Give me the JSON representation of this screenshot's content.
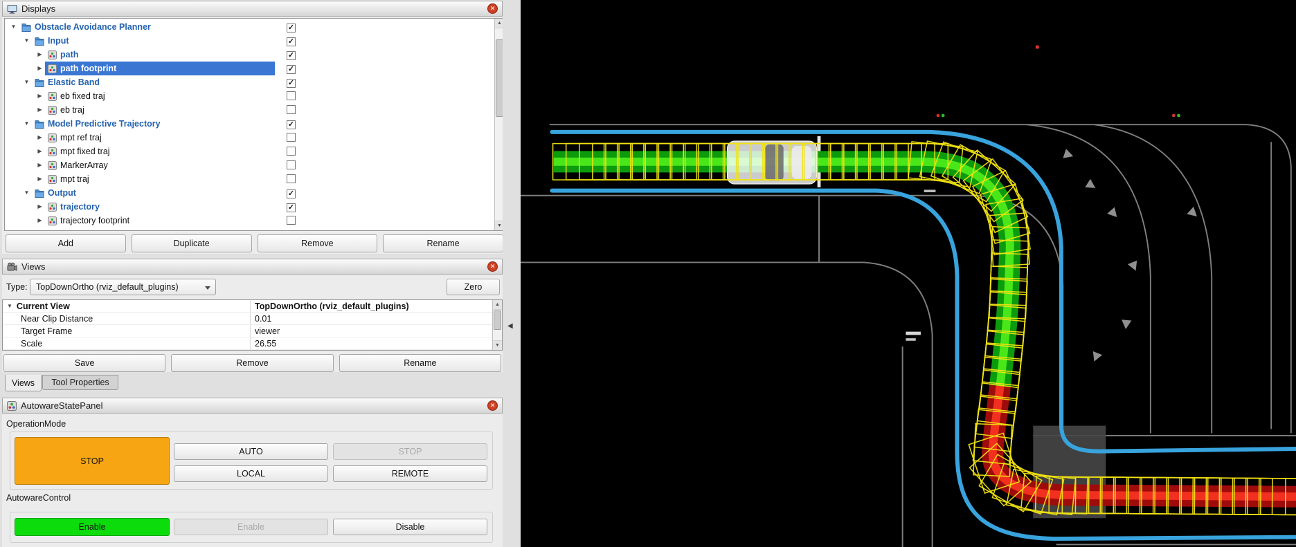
{
  "displays_panel": {
    "title": "Displays",
    "buttons": [
      "Add",
      "Duplicate",
      "Remove",
      "Rename"
    ],
    "tree": [
      {
        "label": "Obstacle Avoidance Planner",
        "level": 0,
        "kind": "folder",
        "expanded": true,
        "checked": true,
        "selected": false
      },
      {
        "label": "Input",
        "level": 1,
        "kind": "folder",
        "expanded": true,
        "checked": true,
        "selected": false
      },
      {
        "label": "path",
        "level": 2,
        "kind": "display",
        "expanded": false,
        "checked": true,
        "selected": false
      },
      {
        "label": "path footprint",
        "level": 2,
        "kind": "display",
        "expanded": false,
        "checked": true,
        "selected": true
      },
      {
        "label": "Elastic Band",
        "level": 1,
        "kind": "folder",
        "expanded": true,
        "checked": true,
        "selected": false
      },
      {
        "label": "eb fixed traj",
        "level": 2,
        "kind": "display",
        "expanded": false,
        "checked": false,
        "selected": false
      },
      {
        "label": "eb traj",
        "level": 2,
        "kind": "display",
        "expanded": false,
        "checked": false,
        "selected": false
      },
      {
        "label": "Model Predictive Trajectory",
        "level": 1,
        "kind": "folder",
        "expanded": true,
        "checked": true,
        "selected": false
      },
      {
        "label": "mpt ref traj",
        "level": 2,
        "kind": "display",
        "expanded": false,
        "checked": false,
        "selected": false
      },
      {
        "label": "mpt fixed traj",
        "level": 2,
        "kind": "display",
        "expanded": false,
        "checked": false,
        "selected": false
      },
      {
        "label": "MarkerArray",
        "level": 2,
        "kind": "display",
        "expanded": false,
        "checked": false,
        "selected": false
      },
      {
        "label": "mpt traj",
        "level": 2,
        "kind": "display",
        "expanded": false,
        "checked": false,
        "selected": false
      },
      {
        "label": "Output",
        "level": 1,
        "kind": "folder",
        "expanded": true,
        "checked": true,
        "selected": false
      },
      {
        "label": "trajectory",
        "level": 2,
        "kind": "display",
        "expanded": false,
        "checked": true,
        "selected": false
      },
      {
        "label": "trajectory footprint",
        "level": 2,
        "kind": "display",
        "expanded": false,
        "checked": false,
        "selected": false
      }
    ]
  },
  "views_panel": {
    "title": "Views",
    "type_label": "Type:",
    "type_value": "TopDownOrtho (rviz_default_plugins)",
    "zero_button": "Zero",
    "rows": [
      {
        "name": "Current View",
        "value": "TopDownOrtho (rviz_default_plugins)"
      },
      {
        "name": "Near Clip Distance",
        "value": "0.01"
      },
      {
        "name": "Target Frame",
        "value": "viewer"
      },
      {
        "name": "Scale",
        "value": "26.55"
      }
    ],
    "buttons": [
      "Save",
      "Remove",
      "Rename"
    ],
    "tabs": [
      "Views",
      "Tool Properties"
    ]
  },
  "state_panel": {
    "title": "AutowareStatePanel",
    "operation_mode": {
      "label": "OperationMode",
      "status": "STOP",
      "status_color": "#f7a512",
      "buttons": [
        "AUTO",
        "STOP",
        "LOCAL",
        "REMOTE"
      ]
    },
    "autoware_control": {
      "label": "AutowareControl",
      "status": "Enable",
      "status_color": "#0cdc0c",
      "buttons": [
        "Enable",
        "Disable"
      ]
    }
  },
  "viz": {
    "colors": {
      "background": "#000000",
      "road_gray": "#969696",
      "lane_blue": "#38a3dc",
      "traj_green": "#0c9b0c",
      "traj_green_core": "#49e719",
      "traj_red": "#9e0b0b",
      "traj_red_core": "#f2301f",
      "footprint_yellow": "#f0e312"
    },
    "footprint": {
      "spacing": 16,
      "length": 62,
      "width": 44
    }
  }
}
